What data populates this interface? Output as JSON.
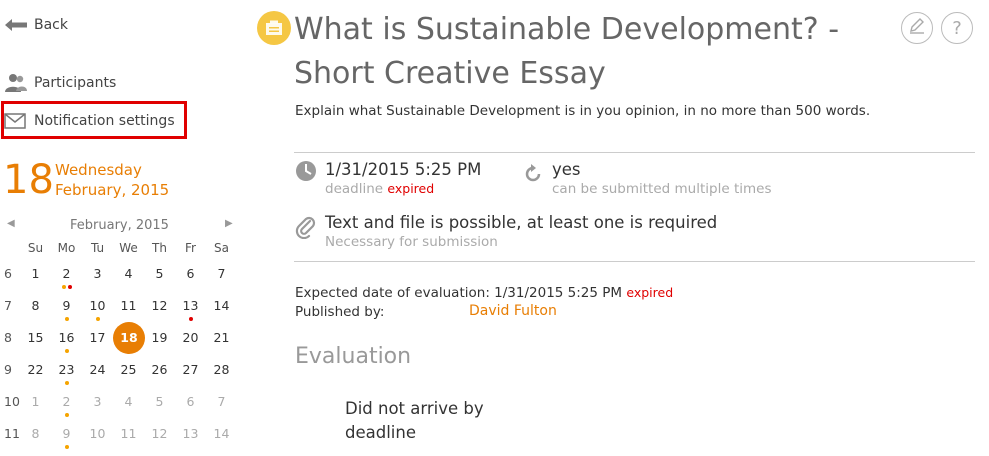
{
  "sidebar": {
    "back_label": "Back",
    "participants_label": "Participants",
    "notification_label": "Notification settings"
  },
  "date": {
    "day_number": "18",
    "weekday": "Wednesday",
    "month_year": "February, 2015"
  },
  "calendar": {
    "month_label": "February, 2015",
    "weekdays": [
      "Su",
      "Mo",
      "Tu",
      "We",
      "Th",
      "Fr",
      "Sa"
    ],
    "weeks": [
      {
        "week": "6",
        "days": [
          {
            "d": "1"
          },
          {
            "d": "2",
            "dots": [
              "o",
              "r"
            ]
          },
          {
            "d": "3"
          },
          {
            "d": "4"
          },
          {
            "d": "5"
          },
          {
            "d": "6"
          },
          {
            "d": "7"
          }
        ]
      },
      {
        "week": "7",
        "days": [
          {
            "d": "8"
          },
          {
            "d": "9",
            "dots": [
              "o"
            ]
          },
          {
            "d": "10",
            "dots": [
              "o"
            ]
          },
          {
            "d": "11"
          },
          {
            "d": "12"
          },
          {
            "d": "13",
            "dots": [
              "r"
            ]
          },
          {
            "d": "14"
          }
        ]
      },
      {
        "week": "8",
        "days": [
          {
            "d": "15"
          },
          {
            "d": "16",
            "dots": [
              "o"
            ]
          },
          {
            "d": "17"
          },
          {
            "d": "18",
            "today": true
          },
          {
            "d": "19"
          },
          {
            "d": "20"
          },
          {
            "d": "21"
          }
        ]
      },
      {
        "week": "9",
        "days": [
          {
            "d": "22"
          },
          {
            "d": "23",
            "dots": [
              "o"
            ]
          },
          {
            "d": "24"
          },
          {
            "d": "25"
          },
          {
            "d": "26"
          },
          {
            "d": "27"
          },
          {
            "d": "28"
          }
        ]
      },
      {
        "week": "10",
        "days": [
          {
            "d": "1",
            "muted": true
          },
          {
            "d": "2",
            "muted": true,
            "dots": [
              "o"
            ]
          },
          {
            "d": "3",
            "muted": true
          },
          {
            "d": "4",
            "muted": true
          },
          {
            "d": "5",
            "muted": true
          },
          {
            "d": "6",
            "muted": true
          },
          {
            "d": "7",
            "muted": true
          }
        ]
      },
      {
        "week": "11",
        "days": [
          {
            "d": "8",
            "muted": true
          },
          {
            "d": "9",
            "muted": true,
            "dots": [
              "o"
            ]
          },
          {
            "d": "10",
            "muted": true
          },
          {
            "d": "11",
            "muted": true
          },
          {
            "d": "12",
            "muted": true
          },
          {
            "d": "13",
            "muted": true
          },
          {
            "d": "14",
            "muted": true
          }
        ]
      }
    ]
  },
  "assignment": {
    "title": "What is Sustainable Development? - Short Creative Essay",
    "description": "Explain what Sustainable Development is in you opinion, in no more than 500 words.",
    "deadline_value": "1/31/2015 5:25 PM",
    "deadline_label": "deadline",
    "expired_label": "expired",
    "multiple_value": "yes",
    "multiple_label": "can be submitted multiple times",
    "submission_value": "Text and file is possible, at least one is required",
    "submission_label": "Necessary for submission",
    "eval_date_label": "Expected date of evaluation: 1/31/2015 5:25 PM",
    "published_by_label": "Published by:",
    "publisher_name": "David Fulton"
  },
  "evaluation": {
    "heading": "Evaluation",
    "line1": "Did not arrive by",
    "line2": "deadline"
  },
  "colors": {
    "accent": "#e87e04",
    "expired": "#e00000",
    "highlight": "#e00000",
    "title_icon": "#f5c744"
  },
  "icons": [
    "back-arrow-icon",
    "participants-icon",
    "envelope-icon",
    "chevron-left-icon",
    "chevron-right-icon",
    "assignment-icon",
    "edit-icon",
    "help-icon",
    "clock-icon",
    "refresh-icon",
    "paperclip-icon"
  ]
}
